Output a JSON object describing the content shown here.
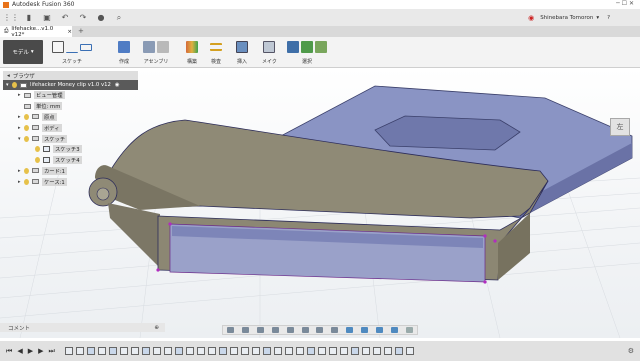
{
  "window": {
    "title": "Autodesk Fusion 360"
  },
  "quick_access": {
    "icons": [
      "grid-icon",
      "file-icon",
      "save-icon",
      "undo-icon",
      "redo-icon",
      "data-icon",
      "search-icon"
    ]
  },
  "user": {
    "name": "Shinebara Tomoron",
    "help": "?"
  },
  "document_tab": {
    "label": "lifehacke...v1.0 v12*"
  },
  "workspace": {
    "label": "モデル"
  },
  "ribbon": {
    "groups": [
      {
        "label": "スケッチ"
      },
      {
        "label": "作成"
      },
      {
        "label": "アセンブリ"
      },
      {
        "label": "構築"
      },
      {
        "label": "検査"
      },
      {
        "label": "挿入"
      },
      {
        "label": "メイク"
      },
      {
        "label": "選択"
      }
    ]
  },
  "viewcube": {
    "face": "左"
  },
  "browser": {
    "header": "ブラウザ",
    "root": "lifehacker Money clip v1.0 v12",
    "items": [
      {
        "label": "ビュー管理"
      },
      {
        "label": "単位: mm"
      },
      {
        "label": "原点"
      },
      {
        "label": "ボディ"
      },
      {
        "label": "スケッチ"
      },
      {
        "label": "スケッチ3"
      },
      {
        "label": "スケッチ4"
      },
      {
        "label": "カード:1"
      },
      {
        "label": "ケース:1"
      }
    ]
  },
  "comments": {
    "label": "コメント"
  },
  "colors": {
    "card": "#7e86b6",
    "clip": "#8a8370",
    "canvas_bg": "#f0f2f4"
  }
}
